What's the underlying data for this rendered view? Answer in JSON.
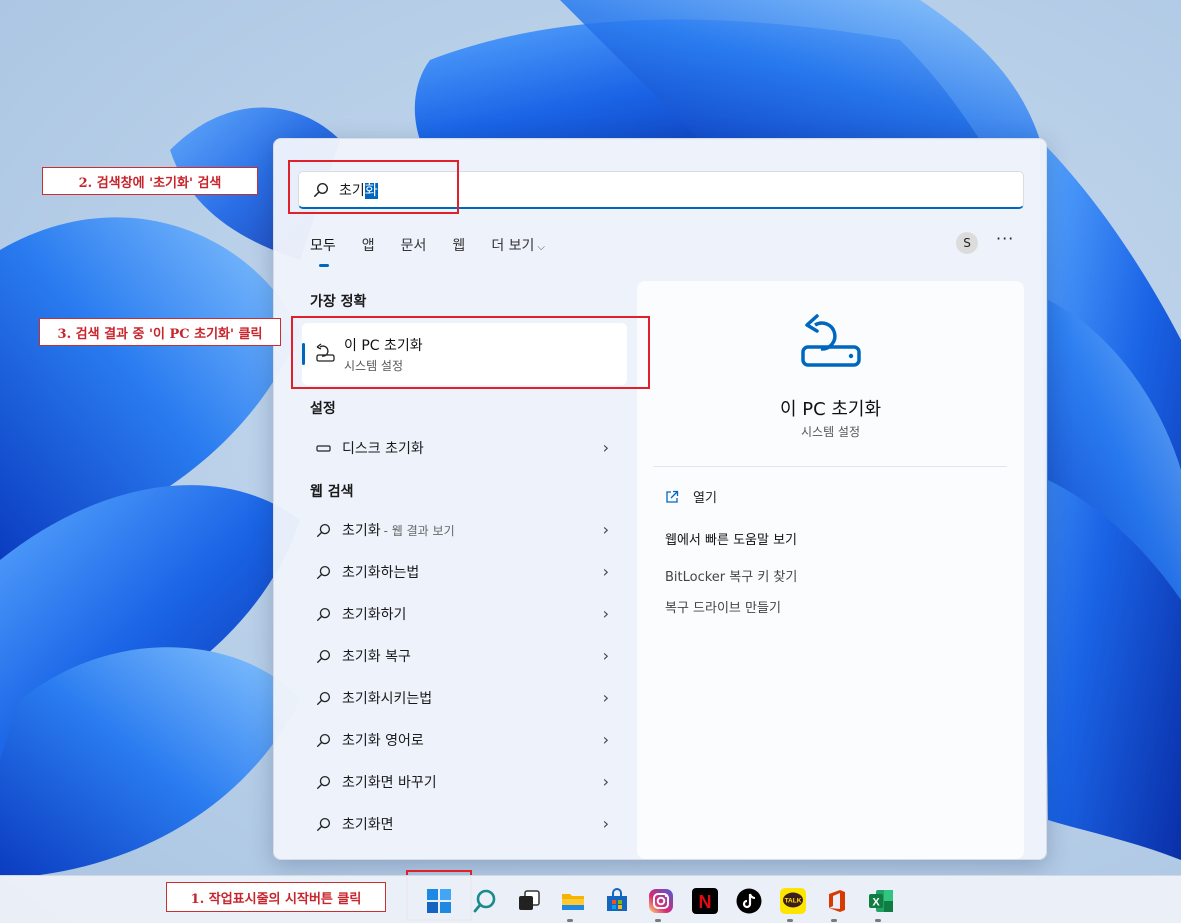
{
  "search": {
    "query_prefix": "초기",
    "query_selected": "화"
  },
  "tabs": [
    {
      "label": "모두"
    },
    {
      "label": "앱"
    },
    {
      "label": "문서"
    },
    {
      "label": "웹"
    },
    {
      "label": "더 보기"
    }
  ],
  "account": {
    "avatar_letter": "S",
    "more_label": "···"
  },
  "sections": {
    "best_match": "가장 정확",
    "settings": "설정",
    "web": "웹 검색"
  },
  "best_match": {
    "title": "이 PC 초기화",
    "subtitle": "시스템 설정"
  },
  "settings_items": [
    {
      "label": "디스크 초기화"
    }
  ],
  "web_items": [
    {
      "label": "초기화",
      "hint": "- 웹 결과 보기"
    },
    {
      "label": "초기화하는법"
    },
    {
      "label": "초기화하기"
    },
    {
      "label": "초기화 복구"
    },
    {
      "label": "초기화시키는법"
    },
    {
      "label": "초기화 영어로"
    },
    {
      "label": "초기화면 바꾸기"
    },
    {
      "label": "초기화면"
    }
  ],
  "detail": {
    "title": "이 PC 초기화",
    "subtitle": "시스템 설정",
    "open_label": "열기",
    "web_heading": "웹에서 빠른 도움말 보기",
    "links": [
      "BitLocker 복구 키 찾기",
      "복구 드라이브 만들기"
    ]
  },
  "annotations": {
    "step1": "1. 작업표시줄의 시작버튼 클릭",
    "step2": "2. 검색창에 '초기화' 검색",
    "step3": "3. 검색 결과 중 '이 PC 초기화' 클릭"
  },
  "taskbar": {
    "netflix_letter": "N",
    "talk_label": "TALK",
    "excel_letter": "X"
  },
  "colors": {
    "accent": "#0067c0",
    "annotation_red": "#e0202a"
  }
}
